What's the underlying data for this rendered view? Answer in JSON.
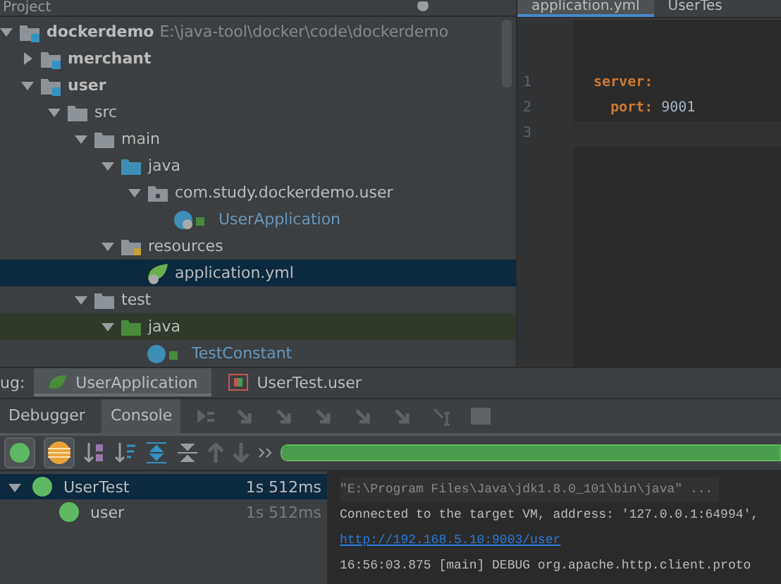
{
  "project_panel": {
    "title": "Project",
    "tree": [
      {
        "label": "dockerdemo",
        "path": "E:\\java-tool\\docker\\code\\dockerdemo",
        "kind": "module",
        "expanded": true,
        "selected": false,
        "children": [
          {
            "label": "merchant",
            "kind": "module",
            "expanded": false,
            "selected": false
          },
          {
            "label": "user",
            "kind": "module",
            "expanded": true,
            "selected": false,
            "children": [
              {
                "label": "src",
                "kind": "folder",
                "expanded": true,
                "selected": false,
                "children": [
                  {
                    "label": "main",
                    "kind": "folder",
                    "expanded": true,
                    "selected": false,
                    "children": [
                      {
                        "label": "java",
                        "kind": "source",
                        "expanded": true,
                        "selected": false,
                        "children": [
                          {
                            "label": "com.study.dockerdemo.user",
                            "kind": "package",
                            "expanded": true,
                            "selected": false,
                            "children": [
                              {
                                "label": "UserApplication",
                                "kind": "spring-class",
                                "selected": false
                              }
                            ]
                          }
                        ]
                      },
                      {
                        "label": "resources",
                        "kind": "resources",
                        "expanded": true,
                        "selected": false,
                        "children": [
                          {
                            "label": "application.yml",
                            "kind": "yml",
                            "selected": true
                          }
                        ]
                      }
                    ]
                  },
                  {
                    "label": "test",
                    "kind": "folder",
                    "expanded": true,
                    "selected": false,
                    "children": [
                      {
                        "label": "java",
                        "kind": "test-source",
                        "expanded": true,
                        "selected": false,
                        "children": [
                          {
                            "label": "TestConstant",
                            "kind": "class",
                            "selected": false
                          }
                        ]
                      }
                    ]
                  }
                ]
              }
            ]
          }
        ]
      }
    ]
  },
  "editor": {
    "tabs": [
      {
        "label": "application.yml",
        "selected": true
      },
      {
        "label": "UserTes",
        "selected": false
      }
    ],
    "line_numbers": [
      "1",
      "2",
      "3"
    ],
    "code": [
      {
        "key": "server:",
        "children": [
          {
            "key": "port:",
            "value": "9001"
          }
        ]
      }
    ]
  },
  "debug_bar": {
    "label": "ug:",
    "tabs": [
      {
        "label": "UserApplication",
        "kind": "spring",
        "selected": true
      },
      {
        "label": "UserTest.user",
        "kind": "test",
        "selected": false
      }
    ]
  },
  "tool_tabs": [
    {
      "label": "Debugger",
      "selected": false
    },
    {
      "label": "Console",
      "selected": true
    }
  ],
  "test_progress": {
    "level": 1.0
  },
  "test_tree": [
    {
      "label": "UserTest",
      "time": "1s 512ms",
      "selected": true,
      "expanded": true,
      "children": [
        {
          "label": "user",
          "time": "1s 512ms",
          "selected": false
        }
      ]
    }
  ],
  "console": [
    {
      "kind": "command",
      "text": "\"E:\\Program Files\\Java\\jdk1.8.0_101\\bin\\java\" ..."
    },
    {
      "kind": "plain",
      "text": "Connected to the target VM, address: '127.0.0.1:64994',"
    },
    {
      "kind": "link",
      "text": "http://192.168.5.10:9003/user"
    },
    {
      "kind": "plain",
      "text": "16:56:03.875 [main] DEBUG org.apache.http.client.proto"
    }
  ]
}
